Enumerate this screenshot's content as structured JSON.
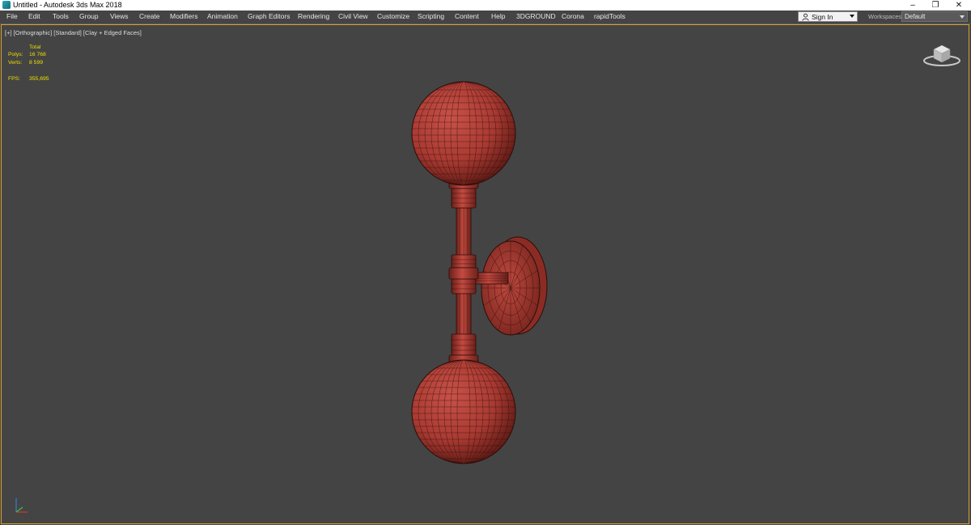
{
  "window": {
    "title": "Untitled - Autodesk 3ds Max 2018",
    "controls": [
      "–",
      "❐",
      "✕"
    ]
  },
  "menubar": {
    "items": [
      "File",
      "Edit",
      "Tools",
      "Group",
      "Views",
      "Create",
      "Modifiers",
      "Animation",
      "Graph Editors",
      "Rendering",
      "Civil View",
      "Customize",
      "Scripting",
      "Content",
      "Help",
      "3DGROUND",
      "Corona",
      "rapidTools"
    ]
  },
  "account": {
    "signin_label": "Sign In"
  },
  "workspaces": {
    "label": "Workspaces:",
    "value": "Default"
  },
  "viewport": {
    "label": "[+] [Orthographic] [Standard] [Clay + Edged Faces]",
    "stats": {
      "total_label": "Total",
      "polys_label": "Polys:",
      "polys_value": "16 768",
      "verts_label": "Verts:",
      "verts_value": "8 599",
      "fps_label": "FPS:",
      "fps_value": "355,695"
    }
  },
  "colors": {
    "viewport_bg": "#444444",
    "model_red": "#b8423a",
    "wire": "#2a0d0a",
    "stats_yellow": "#e9e000",
    "active_border": "#d3a232"
  },
  "icons": {
    "app": "3dsmax-logo-icon",
    "user": "user-icon",
    "viewcube": "viewcube-icon",
    "axis": "axis-tripod-icon"
  }
}
